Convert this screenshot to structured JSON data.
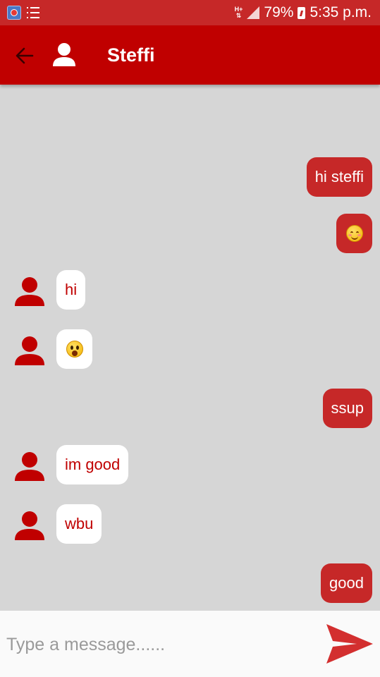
{
  "status_bar": {
    "network_type": "H+",
    "battery_percent": "79%",
    "time": "5:35 p.m.",
    "icons": [
      "app-notification-icon",
      "list-notification-icon",
      "network-hplus-icon",
      "signal-icon",
      "battery-charging-icon"
    ]
  },
  "app_bar": {
    "title": "Steffi",
    "back_icon": "arrow-left-icon",
    "avatar_icon": "person-icon"
  },
  "messages": [
    {
      "direction": "outgoing",
      "text": "hi steffi"
    },
    {
      "direction": "outgoing",
      "emoji": "smiling-blush-emoji"
    },
    {
      "direction": "incoming",
      "text": "hi"
    },
    {
      "direction": "incoming",
      "emoji": "surprised-emoji"
    },
    {
      "direction": "outgoing",
      "text": "ssup"
    },
    {
      "direction": "incoming",
      "text": "im good"
    },
    {
      "direction": "incoming",
      "text": "wbu"
    },
    {
      "direction": "outgoing",
      "text": "good"
    }
  ],
  "composer": {
    "placeholder": "Type a message......",
    "value": "",
    "send_icon": "send-icon"
  },
  "colors": {
    "primary": "#c00000",
    "status_bar": "#c62828",
    "outgoing_bubble": "#c62828",
    "incoming_bubble": "#ffffff",
    "incoming_text": "#c00000",
    "chat_background": "#d6d6d6"
  }
}
